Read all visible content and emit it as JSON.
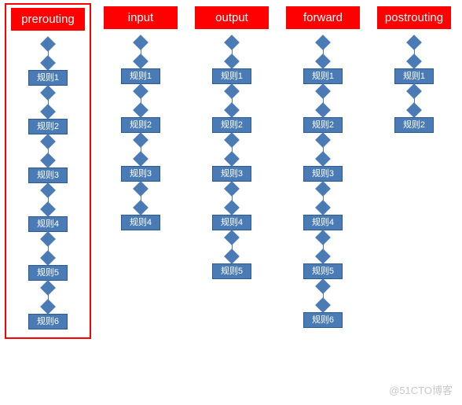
{
  "columns": [
    {
      "id": "prerouting",
      "header": "prerouting",
      "rules": [
        "规则1",
        "规则2",
        "规则3",
        "规则4",
        "规则5",
        "规则6"
      ],
      "highlight": true
    },
    {
      "id": "input",
      "header": "input",
      "rules": [
        "规则1",
        "规则2",
        "规则3",
        "规则4"
      ],
      "highlight": false
    },
    {
      "id": "output",
      "header": "output",
      "rules": [
        "规则1",
        "规则2",
        "规则3",
        "规则4",
        "规则5"
      ],
      "highlight": false
    },
    {
      "id": "forward",
      "header": "forward",
      "rules": [
        "规则1",
        "规则2",
        "规则3",
        "规则4",
        "规则5",
        "规则6"
      ],
      "highlight": false
    },
    {
      "id": "postrouting",
      "header": "postrouting",
      "rules": [
        "规则1",
        "规则2"
      ],
      "highlight": false
    }
  ],
  "watermark": "@51CTO博客",
  "colors": {
    "header_bg": "#ff0000",
    "header_fg": "#ffffff",
    "box_bg": "#4a7bb5",
    "box_fg": "#ffffff",
    "highlight_border": "#ff0000"
  }
}
